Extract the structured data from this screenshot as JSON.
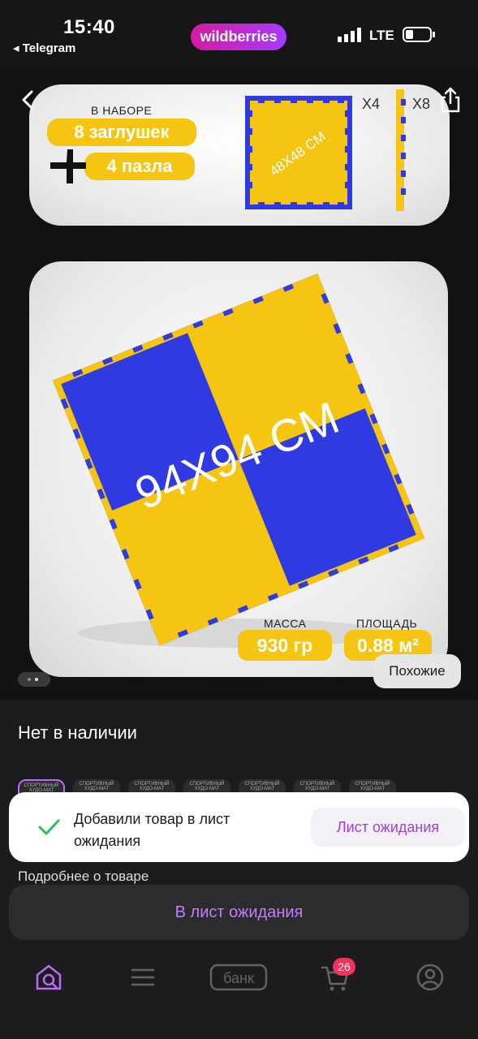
{
  "status_bar": {
    "time": "15:40",
    "back_app": "◂ Telegram",
    "brand": "wildberries",
    "network": "LTE"
  },
  "gallery": {
    "card1": {
      "in_set_label": "В НАБОРЕ",
      "plugs": "8 заглушек",
      "puzzles": "4 пазла",
      "tile_size": "48Х48 СМ",
      "tile_count": "Х4",
      "strip_count": "Х8"
    },
    "card2": {
      "size_text": "94Х94 СМ",
      "mass_label": "МАССА",
      "mass_value": "930 гр",
      "area_label": "ПЛОЩАДЬ",
      "area_value": "0.88 м²"
    },
    "similar_button": "Похожие"
  },
  "product": {
    "availability": "Нет в наличии",
    "variant_label": "СПОРТИВНЫЙ ХУДО-МАТ",
    "details_link": "Подробнее о товаре"
  },
  "toast": {
    "message": "Добавили товар в лист ожидания",
    "action": "Лист ожидания"
  },
  "wait_button": "В лист ожидания",
  "tabbar": {
    "bank_label": "банк",
    "cart_badge": "26"
  },
  "colors": {
    "yellow": "#f6c512",
    "blue": "#2f3be0",
    "accent": "#c27cff",
    "badge": "#f2335f"
  }
}
